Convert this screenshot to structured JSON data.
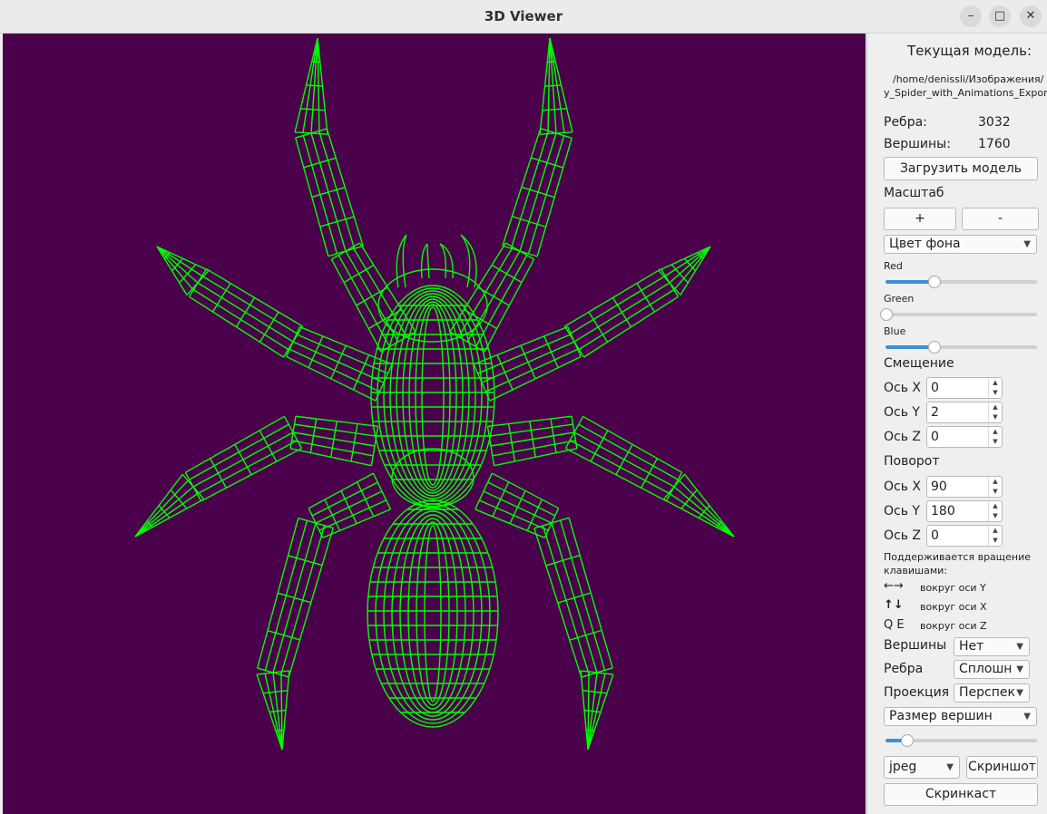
{
  "window": {
    "title": "3D Viewer",
    "minimize": "–",
    "maximize": "□",
    "close": "✕"
  },
  "model": {
    "header": "Текущая модель:",
    "path_line1": "/home/denissli/Изображения/",
    "path_line2": "y_Spider_with_Animations_Export",
    "edges_label": "Ребра:",
    "edges_value": "3032",
    "vertices_label": "Вершины:",
    "vertices_value": "1760",
    "load_button": "Загрузить модель"
  },
  "scale": {
    "label": "Масштаб",
    "plus": "+",
    "minus": "-"
  },
  "background": {
    "combo": "Цвет фона",
    "red_label": "Red",
    "red_level": 0.32,
    "green_label": "Green",
    "green_level": 0.0,
    "blue_label": "Blue",
    "blue_level": 0.32,
    "color": "#4a004a"
  },
  "offset": {
    "label": "Смещение",
    "x_label": "Ось X",
    "x_value": "0",
    "y_label": "Ось Y",
    "y_value": "2",
    "z_label": "Ось Z",
    "z_value": "0"
  },
  "rotation": {
    "label": "Поворот",
    "x_label": "Ось X",
    "x_value": "90",
    "y_label": "Ось Y",
    "y_value": "180",
    "z_label": "Ось Z",
    "z_value": "0"
  },
  "keys": {
    "info1": "Поддерживается вращение",
    "info2": "клавишами:",
    "lr_keys": "←→",
    "lr_text": "вокруг оси Y",
    "ud_keys": "↑↓",
    "ud_text": "вокруг оси X",
    "qe_keys": "Q E",
    "qe_text": "вокруг оси Z"
  },
  "display": {
    "vertices_label": "Вершины",
    "vertices_value": "Нет",
    "edges_label": "Ребра",
    "edges_value": "Сплошн",
    "projection_label": "Проекция",
    "projection_value": "Перспек",
    "vertex_size_combo": "Размер вершин",
    "vertex_size_level": 0.14
  },
  "export": {
    "format": "jpeg",
    "screenshot": "Скриншот",
    "screencast": "Скринкаст"
  },
  "colors": {
    "wire": "#00ff00",
    "accent": "#3d8fd6"
  }
}
